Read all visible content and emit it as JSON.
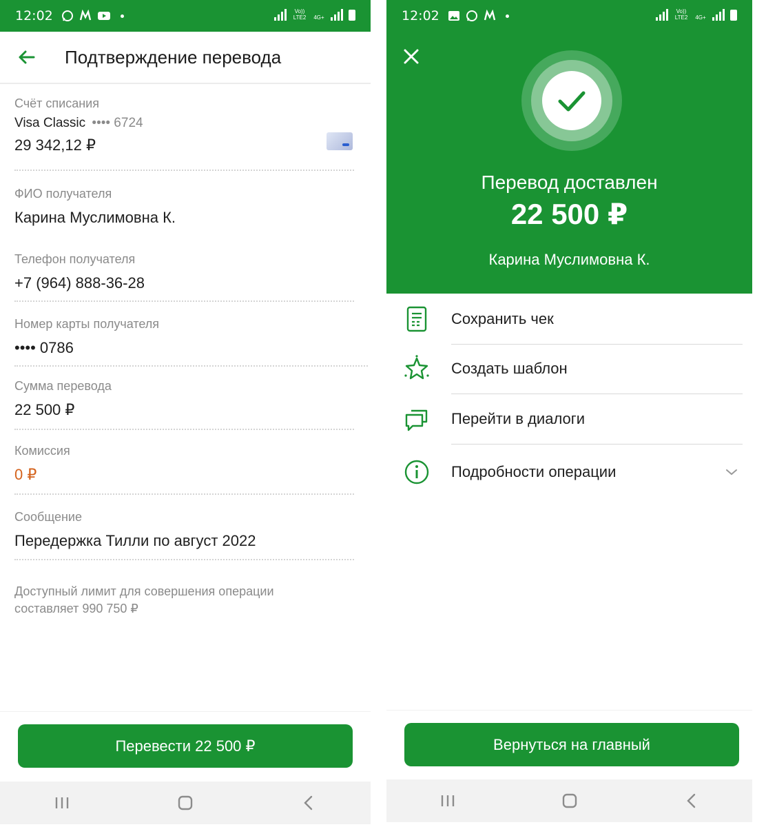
{
  "left": {
    "status": {
      "time": "12:02",
      "net1": "Vo)) LTE2",
      "net2": "4G+"
    },
    "header": {
      "title": "Подтверждение перевода"
    },
    "fields": {
      "account_label": "Счёт списания",
      "card_name": "Visa Classic",
      "card_mask": "•••• 6724",
      "balance": "29 342,12 ₽",
      "name_label": "ФИО получателя",
      "name_value": "Карина Муслимовна К.",
      "phone_label": "Телефон получателя",
      "phone_value": "+7 (964) 888-36-28",
      "cardnum_label": "Номер карты получателя",
      "cardnum_value": "•••• 0786",
      "amount_label": "Сумма перевода",
      "amount_value": "22 500 ₽",
      "fee_label": "Комиссия",
      "fee_value": "0 ₽",
      "msg_label": "Сообщение",
      "msg_value": "Передержка Тилли по август 2022"
    },
    "limit_note": "Доступный лимит для совершения операции составляет 990 750 ₽",
    "submit_label": "Перевести 22 500 ₽"
  },
  "right": {
    "status": {
      "time": "12:02",
      "net1": "Vo)) LTE2",
      "net2": "4G+"
    },
    "success": {
      "title": "Перевод доставлен",
      "amount": "22 500 ₽",
      "recipient": "Карина Муслимовна К."
    },
    "actions": [
      {
        "label": "Сохранить чек",
        "icon": "receipt-icon"
      },
      {
        "label": "Создать шаблон",
        "icon": "star-icon"
      },
      {
        "label": "Перейти в диалоги",
        "icon": "chat-icon"
      },
      {
        "label": "Подробности операции",
        "icon": "info-icon"
      }
    ],
    "home_label": "Вернуться на главный"
  },
  "colors": {
    "brand_green": "#1a9333",
    "fee_orange": "#d4621c",
    "label_gray": "#8a8a8a"
  }
}
